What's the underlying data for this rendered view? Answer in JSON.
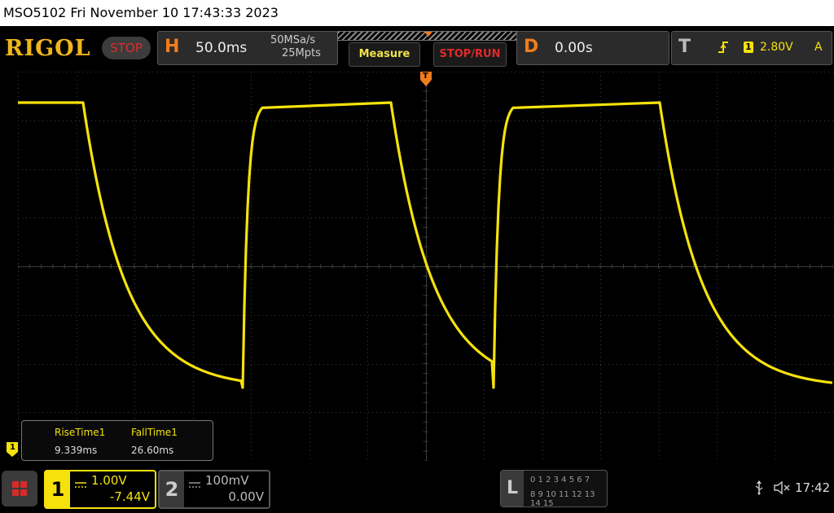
{
  "title_bar": {
    "text": "MSO5102  Fri November 10 17:43:33 2023"
  },
  "brand": {
    "logo": "RIGOL",
    "status": "STOP"
  },
  "horizontal": {
    "letter": "H",
    "timebase": "50.0ms",
    "sample_rate": "50MSa/s",
    "memory_depth": "25Mpts"
  },
  "buttons": {
    "measure": "Measure",
    "stop_run": "STOP/RUN"
  },
  "delay": {
    "letter": "D",
    "value": "0.00s"
  },
  "trigger": {
    "letter": "T",
    "source": "1",
    "level": "2.80V",
    "mode": "A",
    "marker": "T"
  },
  "measurements": {
    "items": [
      {
        "label": "RiseTime1",
        "value": "9.339ms"
      },
      {
        "label": "FallTime1",
        "value": "26.60ms"
      }
    ]
  },
  "channel1": {
    "number": "1",
    "scale": "1.00V",
    "offset": "-7.44V",
    "ground_marker": "1",
    "color": "#f5e20c"
  },
  "channel2": {
    "number": "2",
    "scale": "100mV",
    "offset": "0.00V"
  },
  "logic": {
    "letter": "L",
    "row1": "0 1 2 3  4 5 6 7",
    "row2": "8  9 10 11  12 13 14 15"
  },
  "system": {
    "clock": "17:42",
    "usb_icon": "usb-icon",
    "mute_icon": "speaker-muted-icon",
    "menu_icon": "app-menu-icon"
  },
  "colors": {
    "accent": "#f07d1e",
    "trace": "#f5e20c",
    "stop_red": "#e02b2b",
    "grid": "#3a3a3a"
  }
}
